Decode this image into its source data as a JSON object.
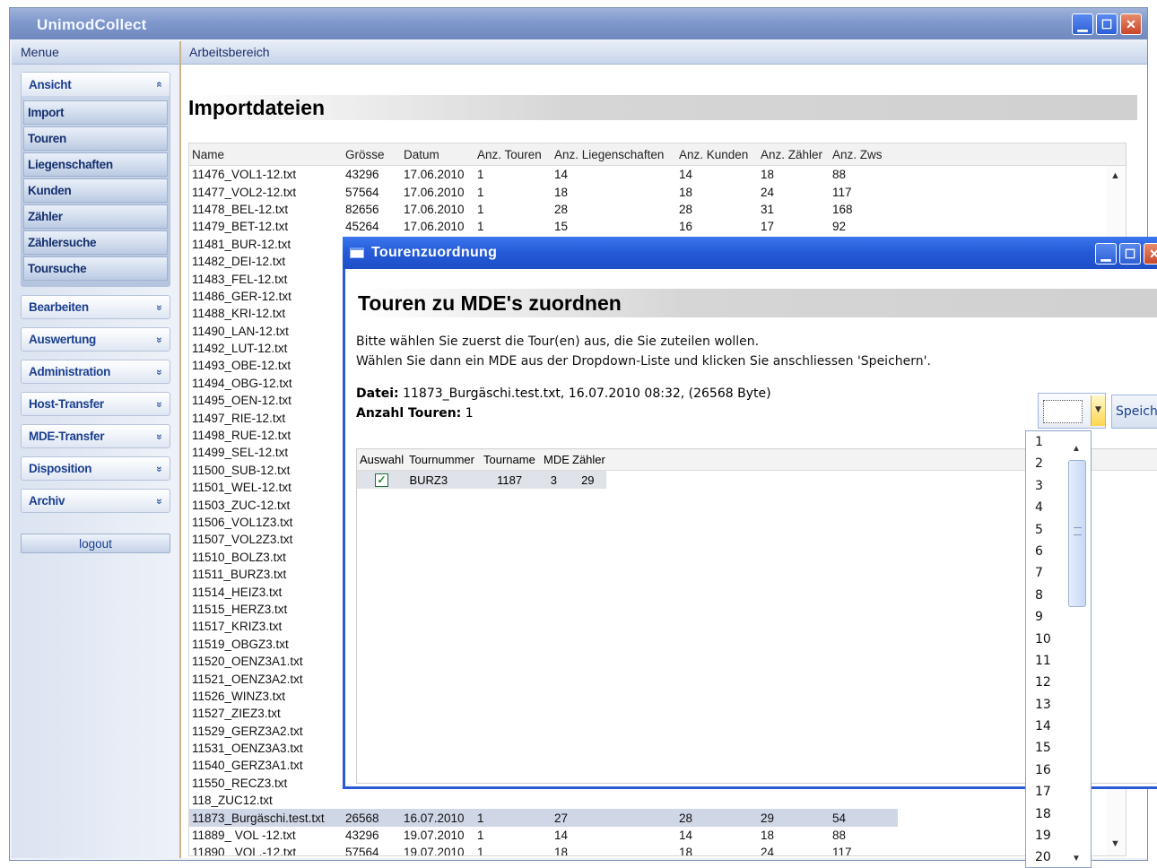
{
  "window": {
    "title": "UnimodCollect",
    "controls": {
      "minimize": "▁",
      "maximize": "☐",
      "close": "✕"
    }
  },
  "menu": {
    "header": "Menue",
    "ansicht": {
      "label": "Ansicht",
      "items": [
        "Import",
        "Touren",
        "Liegenschaften",
        "Kunden",
        "Zähler",
        "Zählersuche",
        "Toursuche"
      ]
    },
    "groups": [
      "Bearbeiten",
      "Auswertung",
      "Administration",
      "Host-Transfer",
      "MDE-Transfer",
      "Disposition",
      "Archiv"
    ],
    "logout": "logout"
  },
  "work": {
    "header": "Arbeitsbereich",
    "title": "Importdateien",
    "columns": [
      "Name",
      "Grösse",
      "Datum",
      "Anz. Touren",
      "Anz. Liegenschaften",
      "Anz. Kunden",
      "Anz. Zähler",
      "Anz. Zws"
    ],
    "rows": [
      [
        "11476_VOL1-12.txt",
        "43296",
        "17.06.2010",
        "1",
        "14",
        "14",
        "18",
        "88"
      ],
      [
        "11477_VOL2-12.txt",
        "57564",
        "17.06.2010",
        "1",
        "18",
        "18",
        "24",
        "117"
      ],
      [
        "11478_BEL-12.txt",
        "82656",
        "17.06.2010",
        "1",
        "28",
        "28",
        "31",
        "168"
      ],
      [
        "11479_BET-12.txt",
        "45264",
        "17.06.2010",
        "1",
        "15",
        "16",
        "17",
        "92"
      ],
      [
        "11481_BUR-12.txt",
        "",
        "",
        "",
        "",
        "",
        "",
        ""
      ],
      [
        "11482_DEI-12.txt",
        "",
        "",
        "",
        "",
        "",
        "",
        ""
      ],
      [
        "11483_FEL-12.txt",
        "",
        "",
        "",
        "",
        "",
        "",
        ""
      ],
      [
        "11486_GER-12.txt",
        "",
        "",
        "",
        "",
        "",
        "",
        ""
      ],
      [
        "11488_KRI-12.txt",
        "",
        "",
        "",
        "",
        "",
        "",
        ""
      ],
      [
        "11490_LAN-12.txt",
        "",
        "",
        "",
        "",
        "",
        "",
        ""
      ],
      [
        "11492_LUT-12.txt",
        "",
        "",
        "",
        "",
        "",
        "",
        ""
      ],
      [
        "11493_OBE-12.txt",
        "",
        "",
        "",
        "",
        "",
        "",
        ""
      ],
      [
        "11494_OBG-12.txt",
        "",
        "",
        "",
        "",
        "",
        "",
        ""
      ],
      [
        "11495_OEN-12.txt",
        "",
        "",
        "",
        "",
        "",
        "",
        ""
      ],
      [
        "11497_RIE-12.txt",
        "",
        "",
        "",
        "",
        "",
        "",
        ""
      ],
      [
        "11498_RUE-12.txt",
        "",
        "",
        "",
        "",
        "",
        "",
        ""
      ],
      [
        "11499_SEL-12.txt",
        "",
        "",
        "",
        "",
        "",
        "",
        ""
      ],
      [
        "11500_SUB-12.txt",
        "",
        "",
        "",
        "",
        "",
        "",
        ""
      ],
      [
        "11501_WEL-12.txt",
        "",
        "",
        "",
        "",
        "",
        "",
        ""
      ],
      [
        "11503_ZUC-12.txt",
        "",
        "",
        "",
        "",
        "",
        "",
        ""
      ],
      [
        "11506_VOL1Z3.txt",
        "",
        "",
        "",
        "",
        "",
        "",
        ""
      ],
      [
        "11507_VOL2Z3.txt",
        "",
        "",
        "",
        "",
        "",
        "",
        ""
      ],
      [
        "11510_BOLZ3.txt",
        "",
        "",
        "",
        "",
        "",
        "",
        ""
      ],
      [
        "11511_BURZ3.txt",
        "",
        "",
        "",
        "",
        "",
        "",
        ""
      ],
      [
        "11514_HEIZ3.txt",
        "",
        "",
        "",
        "",
        "",
        "",
        ""
      ],
      [
        "11515_HERZ3.txt",
        "",
        "",
        "",
        "",
        "",
        "",
        ""
      ],
      [
        "11517_KRIZ3.txt",
        "",
        "",
        "",
        "",
        "",
        "",
        ""
      ],
      [
        "11519_OBGZ3.txt",
        "",
        "",
        "",
        "",
        "",
        "",
        ""
      ],
      [
        "11520_OENZ3A1.txt",
        "",
        "",
        "",
        "",
        "",
        "",
        ""
      ],
      [
        "11521_OENZ3A2.txt",
        "",
        "",
        "",
        "",
        "",
        "",
        ""
      ],
      [
        "11526_WINZ3.txt",
        "",
        "",
        "",
        "",
        "",
        "",
        ""
      ],
      [
        "11527_ZIEZ3.txt",
        "",
        "",
        "",
        "",
        "",
        "",
        ""
      ],
      [
        "11529_GERZ3A2.txt",
        "",
        "",
        "",
        "",
        "",
        "",
        ""
      ],
      [
        "11531_OENZ3A3.txt",
        "",
        "",
        "",
        "",
        "",
        "",
        ""
      ],
      [
        "11540_GERZ3A1.txt",
        "",
        "",
        "",
        "",
        "",
        "",
        ""
      ],
      [
        "11550_RECZ3.txt",
        "",
        "",
        "",
        "",
        "",
        "",
        ""
      ],
      [
        "118_ZUC12.txt",
        "",
        "",
        "",
        "",
        "",
        "",
        ""
      ],
      [
        "11873_Burgäschi.test.txt",
        "26568",
        "16.07.2010",
        "1",
        "27",
        "28",
        "29",
        "54"
      ],
      [
        "11889_ VOL -12.txt",
        "43296",
        "19.07.2010",
        "1",
        "14",
        "14",
        "18",
        "88"
      ],
      [
        "11890_ VOL.-12.txt",
        "57564",
        "19.07.2010",
        "1",
        "18",
        "18",
        "24",
        "117"
      ]
    ],
    "selected_row": 37
  },
  "dialog": {
    "title": "Tourenzuordnung",
    "heading": "Touren zu MDE's zuordnen",
    "text1": "Bitte wählen Sie zuerst die Tour(en) aus, die Sie zuteilen wollen.",
    "text2": "Wählen Sie dann ein MDE aus der Dropdown-Liste und klicken Sie anschliessen 'Speichern'.",
    "datei_label": "Datei:",
    "datei_value": "11873_Burgäschi.test.txt, 16.07.2010 08:32, (26568 Byte)",
    "anzahl_label": "Anzahl Touren:",
    "anzahl_value": "1",
    "save_label": "Speichern",
    "grid": {
      "columns": [
        "Auswahl",
        "Tournummer",
        "Tourname",
        "MDE",
        "Zähler"
      ],
      "rows": [
        {
          "checked": true,
          "tournummer": "BURZ3",
          "tourname": "1187",
          "mde": "3",
          "zaehler": "29"
        }
      ]
    }
  },
  "dropdown": {
    "options": [
      "1",
      "2",
      "3",
      "4",
      "5",
      "6",
      "7",
      "8",
      "9",
      "10",
      "11",
      "12",
      "13",
      "14",
      "15",
      "16",
      "17",
      "18",
      "19",
      "20"
    ]
  },
  "icons": {
    "expand": "«",
    "collapse": "»",
    "up": "▲",
    "down": "▼",
    "check": "✓"
  },
  "colors": {
    "title_blue": "#2559d6",
    "menu_text": "#1b3f8f",
    "selected_row": "#cfd6e6"
  }
}
